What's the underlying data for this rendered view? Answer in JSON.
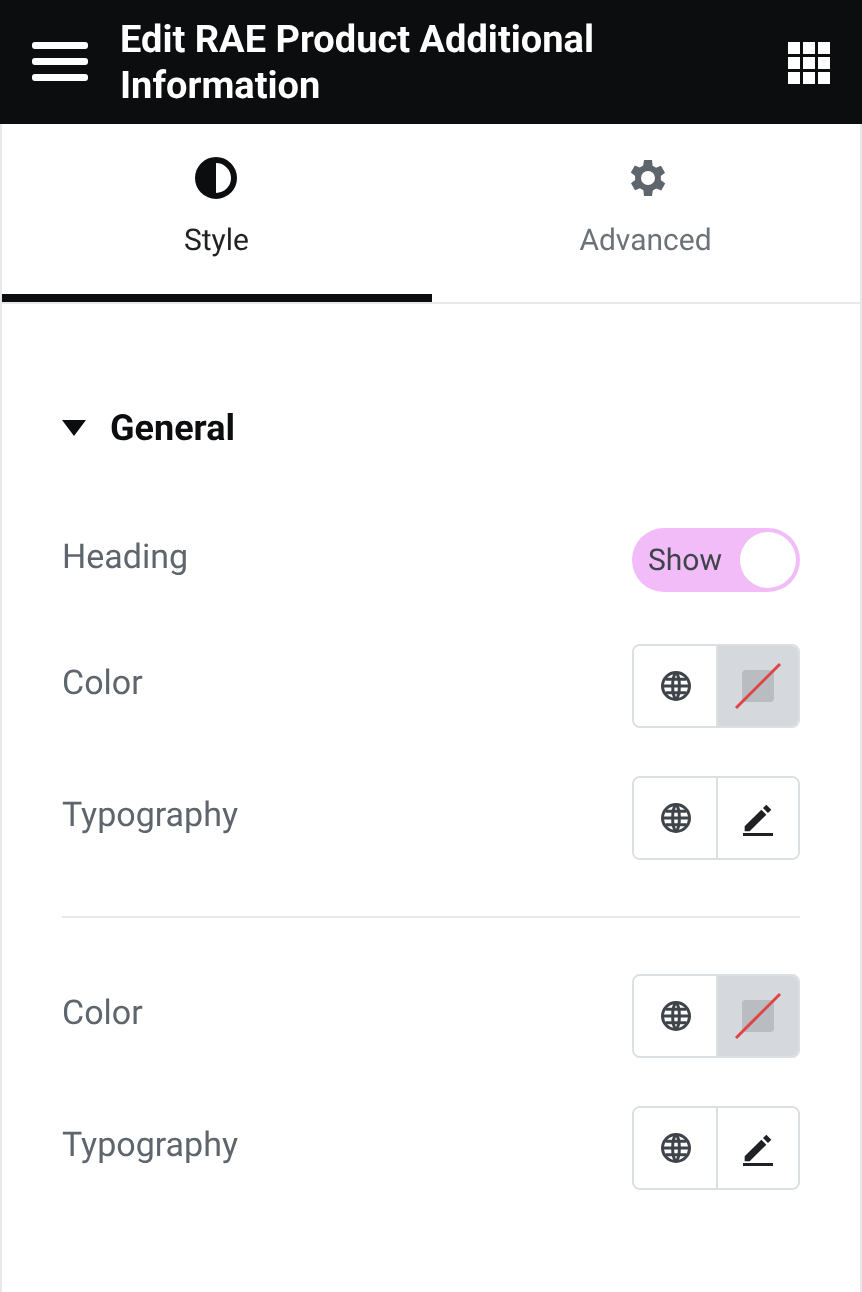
{
  "header": {
    "title": "Edit RAE Product Additional Information"
  },
  "tabs": [
    {
      "label": "Style",
      "selected": true,
      "kind": "style"
    },
    {
      "label": "Advanced",
      "selected": false,
      "kind": "advanced"
    }
  ],
  "section": {
    "title": "General",
    "expanded": true,
    "controls": [
      {
        "kind": "switch",
        "label": "Heading",
        "on": true,
        "switch_text": "Show"
      },
      {
        "kind": "color",
        "label": "Color"
      },
      {
        "kind": "typography",
        "label": "Typography"
      },
      {
        "kind": "divider"
      },
      {
        "kind": "color",
        "label": "Color"
      },
      {
        "kind": "typography",
        "label": "Typography"
      }
    ]
  }
}
